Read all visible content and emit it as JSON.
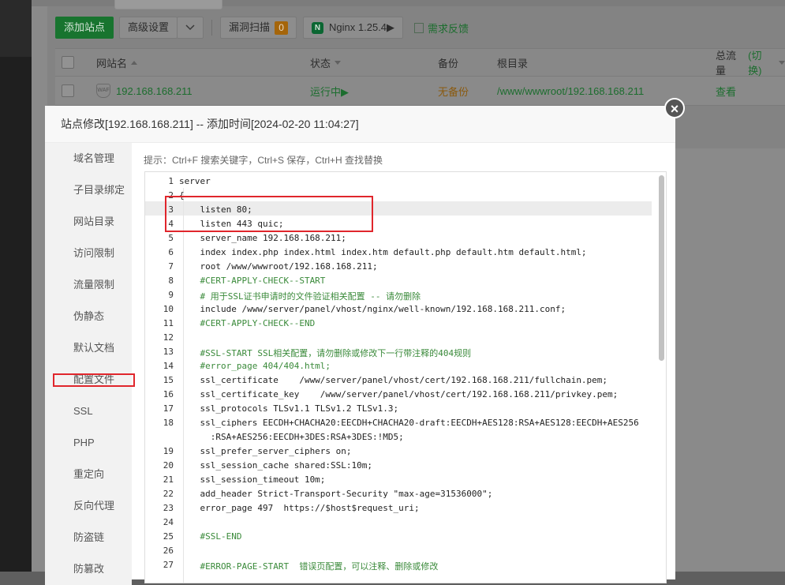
{
  "toolbar": {
    "add_site": "添加站点",
    "advanced": "高级设置",
    "vuln_scan": "漏洞扫描",
    "vuln_count": "0",
    "nginx": "Nginx 1.25.4▶",
    "feedback": "需求反馈"
  },
  "table": {
    "headers": {
      "name": "网站名",
      "status": "状态",
      "backup": "备份",
      "root": "根目录",
      "traffic": "总流量",
      "traffic_switch": "(切换)"
    },
    "rows": [
      {
        "name": "192.168.168.211",
        "status": "运行中▶",
        "backup": "无备份",
        "root": "/www/wwwroot/192.168.168.211",
        "traffic": "查看"
      }
    ]
  },
  "modal": {
    "title": "站点修改[192.168.168.211] -- 添加时间[2024-02-20 11:04:27]",
    "close": "×",
    "hint": "提示：Ctrl+F 搜索关键字，Ctrl+S 保存，Ctrl+H 查找替换",
    "tabs": [
      "域名管理",
      "子目录绑定",
      "网站目录",
      "访问限制",
      "流量限制",
      "伪静态",
      "默认文档",
      "配置文件",
      "SSL",
      "PHP",
      "重定向",
      "反向代理",
      "防盗链",
      "防篡改"
    ],
    "active_tab": "配置文件"
  },
  "editor": {
    "lines": [
      {
        "n": "1",
        "t": "server"
      },
      {
        "n": "2",
        "t": "{"
      },
      {
        "n": "3",
        "t": "    listen 80;"
      },
      {
        "n": "4",
        "t": "    listen 443 quic;"
      },
      {
        "n": "5",
        "t": "    server_name 192.168.168.211;"
      },
      {
        "n": "6",
        "t": "    index index.php index.html index.htm default.php default.htm default.html;"
      },
      {
        "n": "7",
        "t": "    root /www/wwwroot/192.168.168.211;"
      },
      {
        "n": "8",
        "t": "    #CERT-APPLY-CHECK--START"
      },
      {
        "n": "9",
        "t": "    # 用于SSL证书申请时的文件验证相关配置 -- 请勿删除"
      },
      {
        "n": "10",
        "t": "    include /www/server/panel/vhost/nginx/well-known/192.168.168.211.conf;"
      },
      {
        "n": "11",
        "t": "    #CERT-APPLY-CHECK--END"
      },
      {
        "n": "12",
        "t": ""
      },
      {
        "n": "13",
        "t": "    #SSL-START SSL相关配置，请勿删除或修改下一行带注释的404规则"
      },
      {
        "n": "14",
        "t": "    #error_page 404/404.html;"
      },
      {
        "n": "15",
        "t": "    ssl_certificate    /www/server/panel/vhost/cert/192.168.168.211/fullchain.pem;"
      },
      {
        "n": "16",
        "t": "    ssl_certificate_key    /www/server/panel/vhost/cert/192.168.168.211/privkey.pem;"
      },
      {
        "n": "17",
        "t": "    ssl_protocols TLSv1.1 TLSv1.2 TLSv1.3;"
      },
      {
        "n": "18",
        "t": "    ssl_ciphers EECDH+CHACHA20:EECDH+CHACHA20-draft:EECDH+AES128:RSA+AES128:EECDH+AES256"
      },
      {
        "n": "",
        "t": "      :RSA+AES256:EECDH+3DES:RSA+3DES:!MD5;"
      },
      {
        "n": "19",
        "t": "    ssl_prefer_server_ciphers on;"
      },
      {
        "n": "20",
        "t": "    ssl_session_cache shared:SSL:10m;"
      },
      {
        "n": "21",
        "t": "    ssl_session_timeout 10m;"
      },
      {
        "n": "22",
        "t": "    add_header Strict-Transport-Security \"max-age=31536000\";"
      },
      {
        "n": "23",
        "t": "    error_page 497  https://$host$request_uri;"
      },
      {
        "n": "24",
        "t": ""
      },
      {
        "n": "25",
        "t": "    #SSL-END"
      },
      {
        "n": "26",
        "t": ""
      },
      {
        "n": "27",
        "t": "    #ERROR-PAGE-START  错误页配置，可以注释、删除或修改"
      }
    ]
  }
}
